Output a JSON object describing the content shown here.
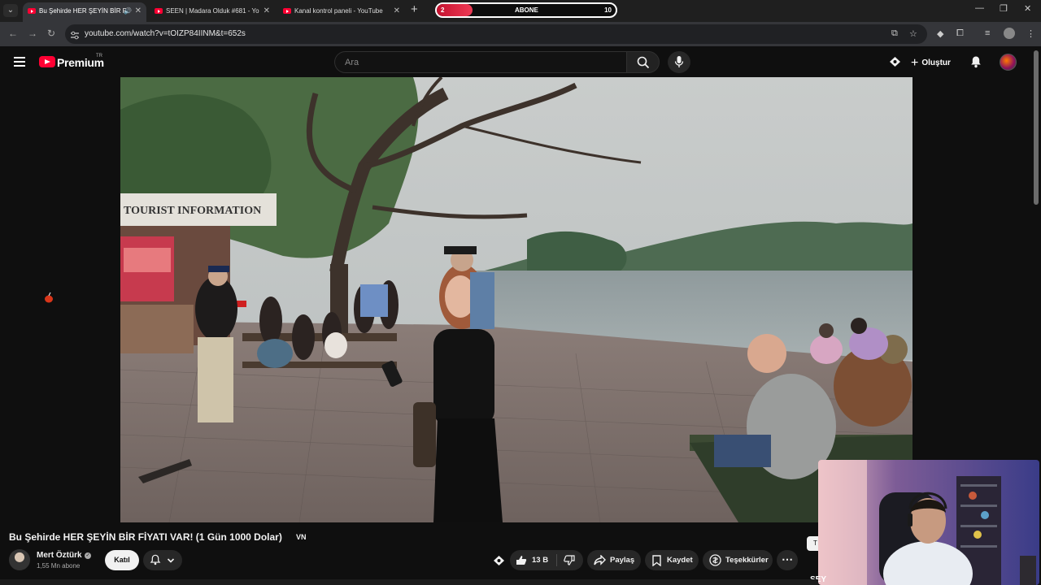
{
  "browser": {
    "tabs": [
      {
        "title": "Bu Şehirde HER ŞEYİN BİR F",
        "active": true
      },
      {
        "title": "SEEN | Madara Olduk #681 - Yo",
        "active": false
      },
      {
        "title": "Kanal kontrol paneli - YouTube",
        "active": false
      }
    ],
    "url": "youtube.com/watch?v=tOIZP84IINM&t=652s",
    "colors": {
      "tabstrip": "#1f1f1f",
      "active_tab": "#35363a"
    }
  },
  "sub_goal": {
    "label": "ABONE",
    "current": "2",
    "target": "10",
    "progress_fraction": 0.2,
    "bar_color": "#e0233f"
  },
  "youtube": {
    "brand": "Premium",
    "country": "TR",
    "search_placeholder": "Ara",
    "create_label": "Oluştur",
    "accent": "#ff0033"
  },
  "video": {
    "title": "Bu Şehirde HER ŞEYİN BİR FİYATI VAR! (1 Gün 1000 Dolar)",
    "title_flag": "VN",
    "sign_text": "TOURIST INFORMATION",
    "channel": {
      "name": "Mert Öztürk",
      "subscribers": "1,55 Mn abone",
      "verified": true
    },
    "join_label": "Katıl",
    "actions": {
      "likes": "13 B",
      "share": "Paylaş",
      "save": "Kaydet",
      "thanks": "Teşekkürler"
    },
    "tooltip_char": "T",
    "watermark": "SEY"
  }
}
